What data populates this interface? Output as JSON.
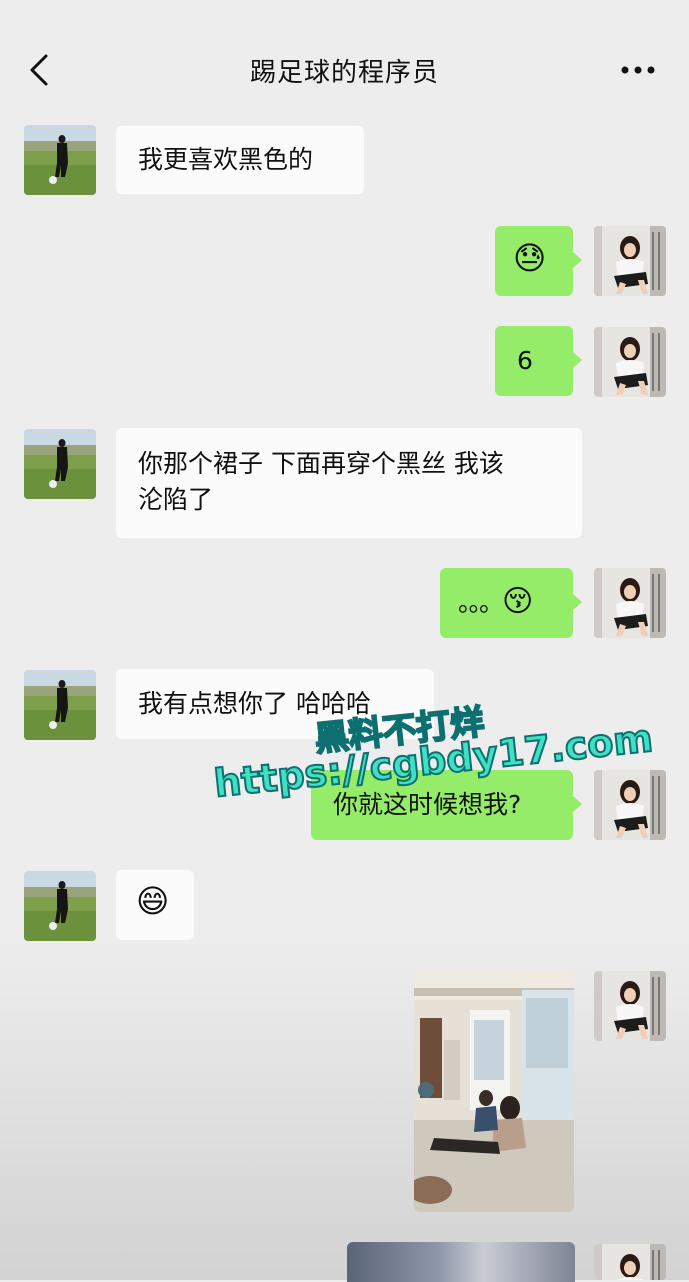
{
  "header": {
    "title": "踢足球的程序员"
  },
  "messages": [
    {
      "side": "left",
      "type": "text",
      "text": "我更喜欢黑色的"
    },
    {
      "side": "right",
      "type": "emoji",
      "emoji": "😓"
    },
    {
      "side": "right",
      "type": "text",
      "text": "6"
    },
    {
      "side": "left",
      "type": "text",
      "line1": "你那个裙子 下面再穿个黑丝 我该",
      "line2": "沦陷了"
    },
    {
      "side": "right",
      "type": "text",
      "text": "。。。",
      "emoji": "😚"
    },
    {
      "side": "left",
      "type": "text",
      "text": "我有点想你了 哈哈哈"
    },
    {
      "side": "right",
      "type": "text",
      "text": "你就这时候想我?"
    },
    {
      "side": "left",
      "type": "emoji",
      "emoji": "😄"
    },
    {
      "side": "right",
      "type": "image"
    },
    {
      "side": "right",
      "type": "image-partial"
    }
  ],
  "watermark": {
    "line1": "黑料不打烊",
    "line2": "https://cgbdy17.com"
  },
  "icons": {
    "back": "chevron-left-icon",
    "more": "more-dots-icon"
  },
  "colors": {
    "background": "#ededed",
    "bubble_right": "#95ec69",
    "bubble_left": "#fbfbfb",
    "watermark": "#3fe0c4"
  }
}
